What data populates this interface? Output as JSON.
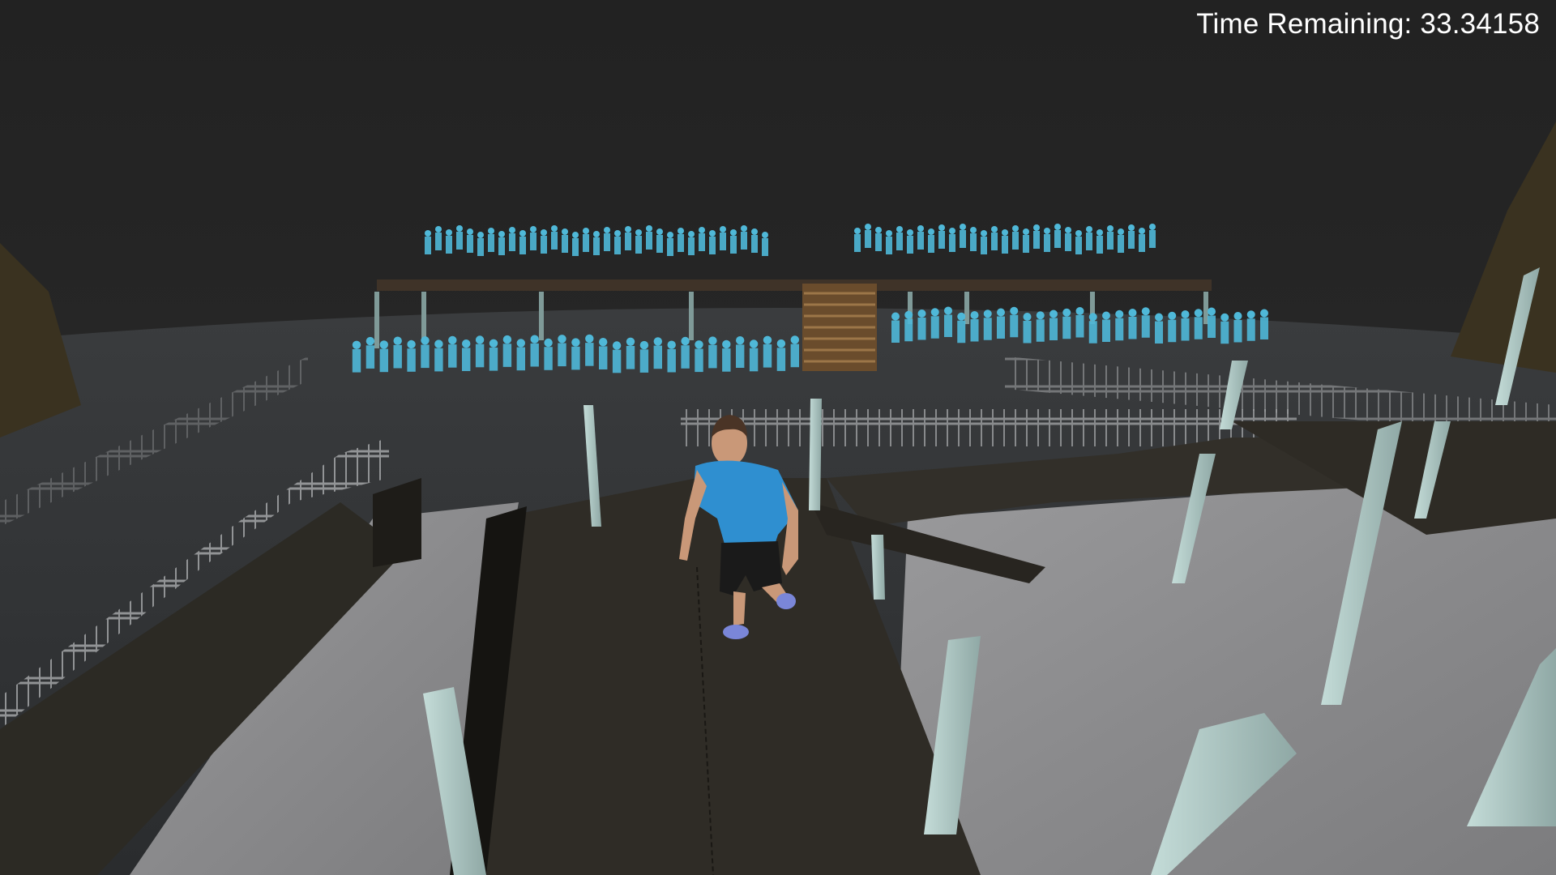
{
  "hud": {
    "timer_label": "Time Remaining:",
    "timer_value": "33.34158"
  },
  "scene": {
    "description_icon": "game-3d-viewport",
    "colors": {
      "sky": "#1f1f1f",
      "ground_dark": "#2a2c2e",
      "floor_gray": "#8c8c8e",
      "platform": "#36332d",
      "pillar": "#a8c2bf",
      "crowd": "#4fb8d8",
      "player_shirt": "#2f8fd0",
      "stairs": "#7a5a36"
    }
  }
}
